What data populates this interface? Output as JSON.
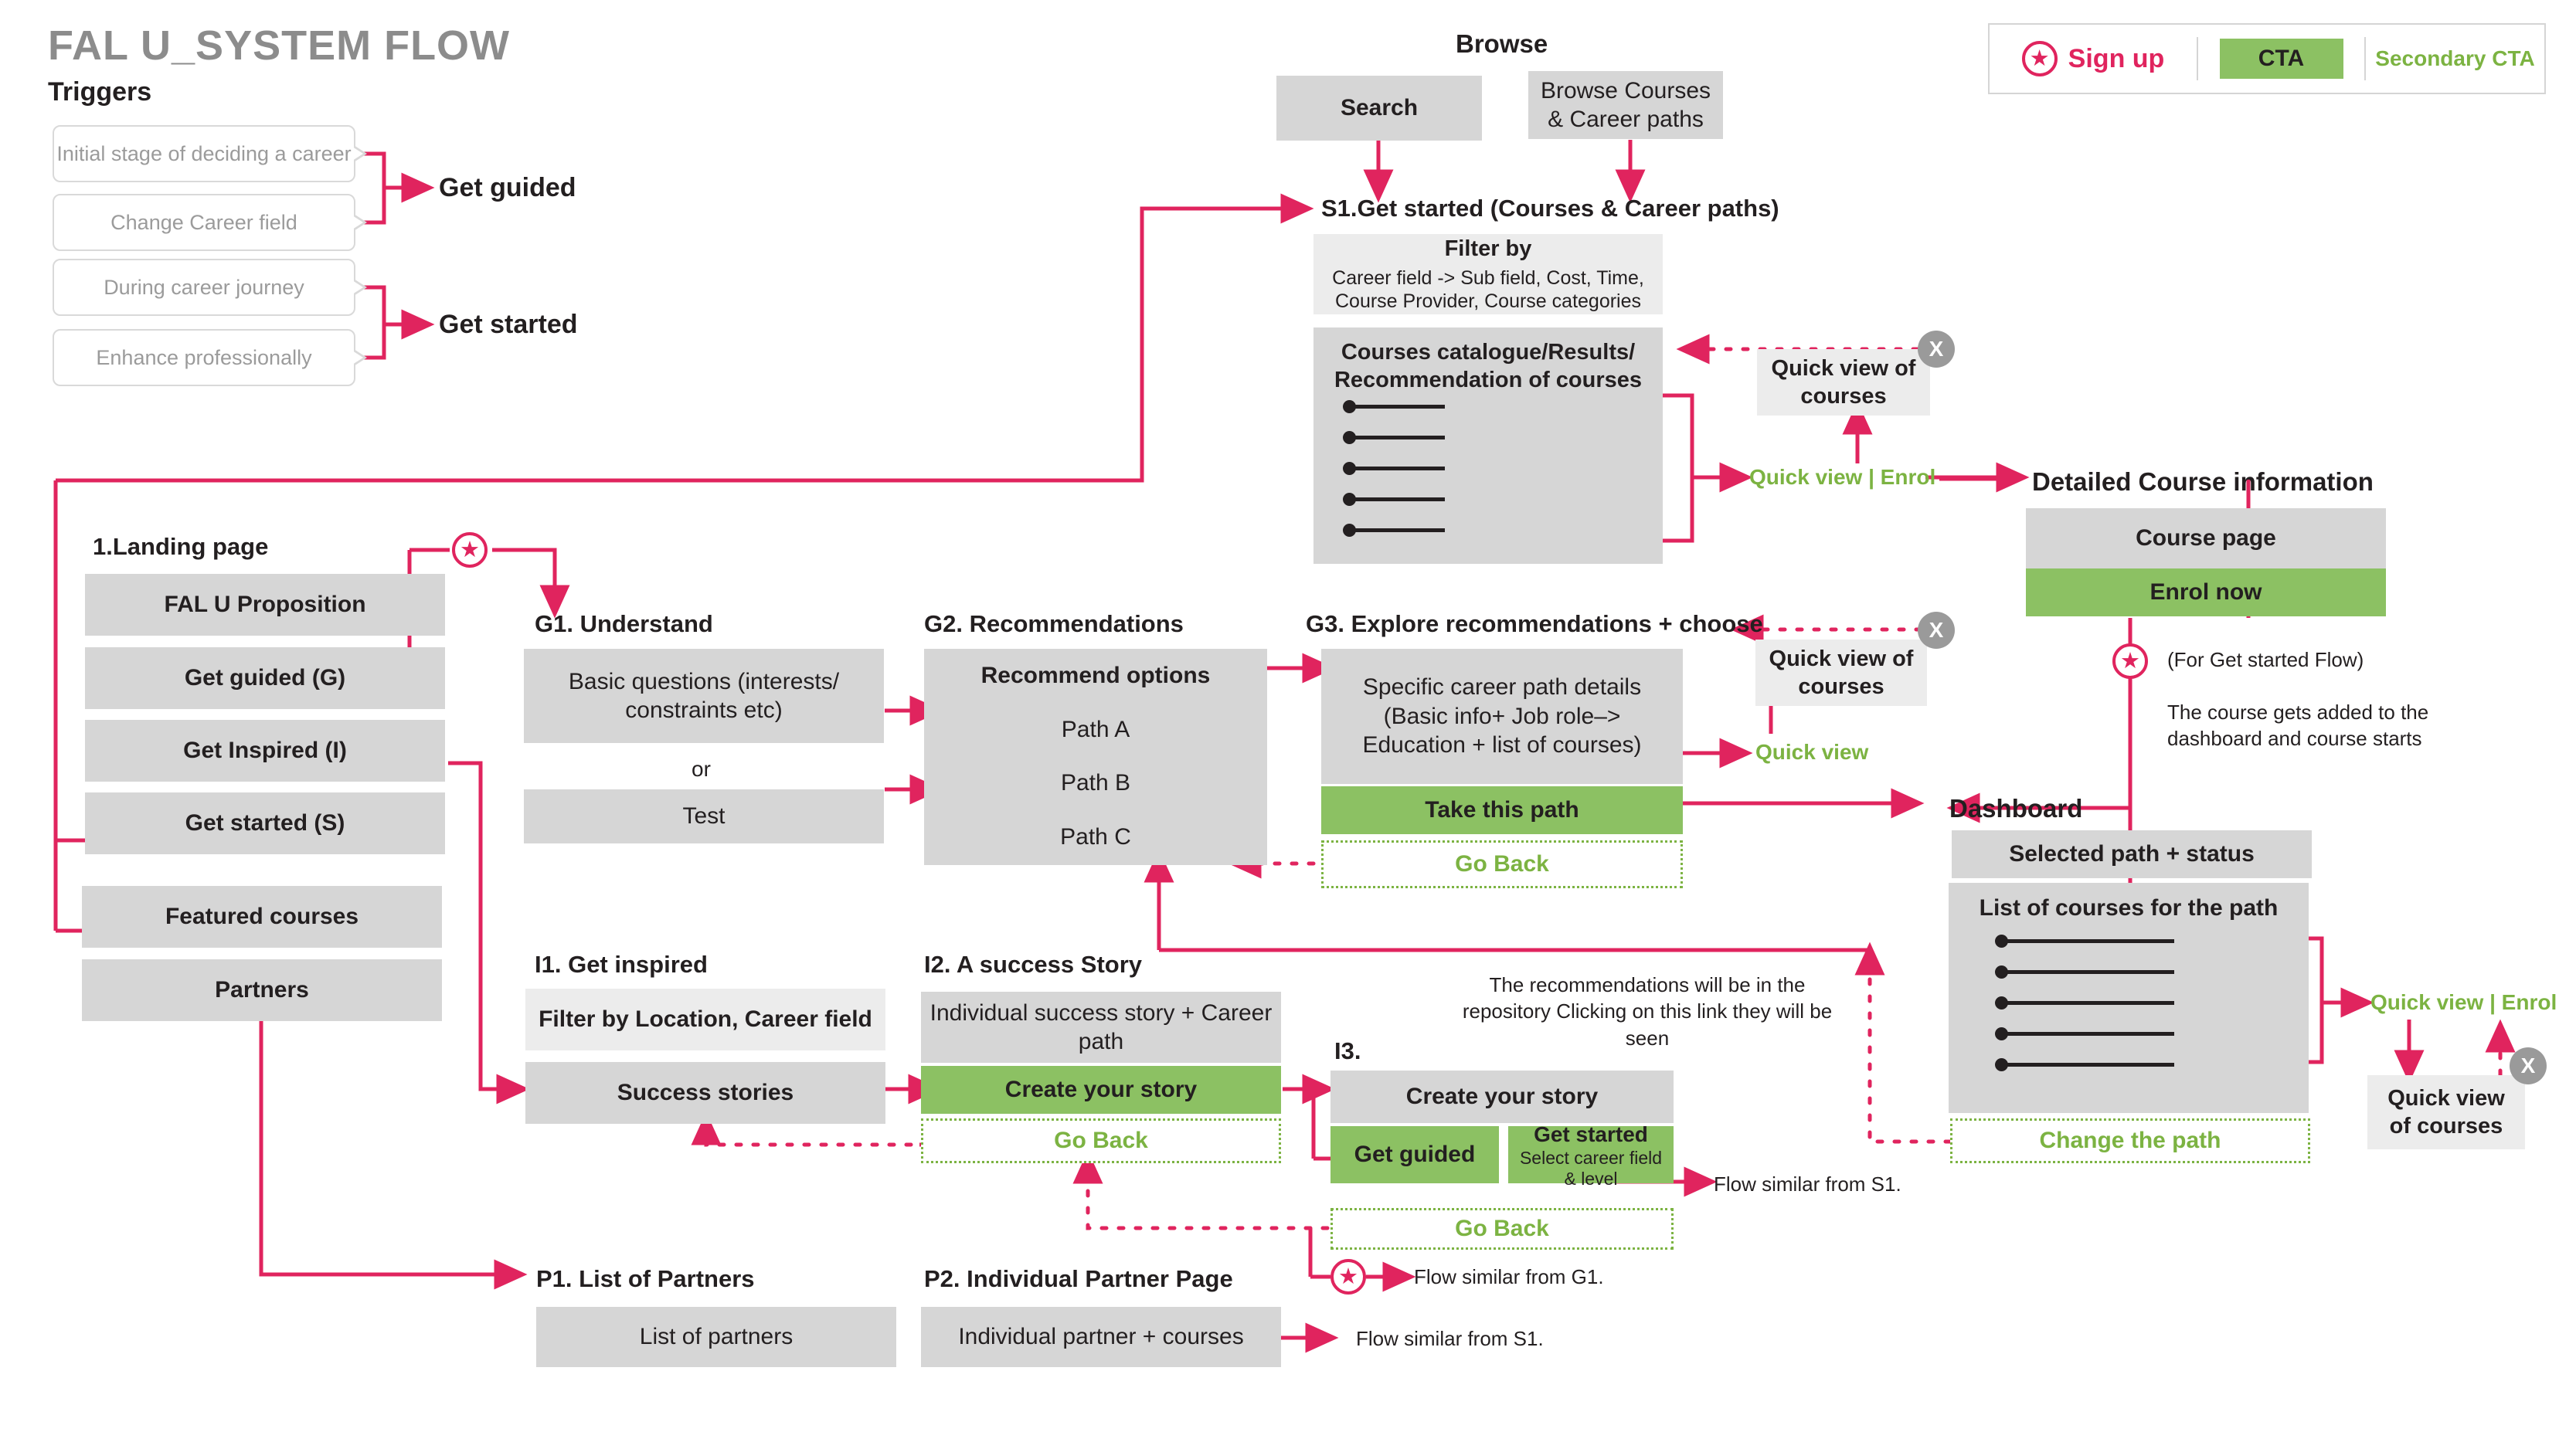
{
  "page": {
    "title": "FAL U_SYSTEM FLOW",
    "triggers_heading": "Triggers"
  },
  "legend": {
    "signup_label": "Sign up",
    "signup_icon": "star-icon",
    "cta_label": "CTA",
    "secondary_cta_label": "Secondary CTA",
    "colors": {
      "pink": "#e0245e",
      "green": "#8cc163",
      "secondary_green": "#7cb342",
      "gray_box": "#d6d6d6"
    }
  },
  "triggers": {
    "items": [
      {
        "label": "Initial stage of deciding a career"
      },
      {
        "label": "Change Career field"
      },
      {
        "label": "During career journey"
      },
      {
        "label": "Enhance professionally"
      }
    ],
    "outcomes": [
      {
        "label": "Get guided"
      },
      {
        "label": "Get started"
      }
    ]
  },
  "browse": {
    "heading": "Browse",
    "search_label": "Search",
    "browse_label": "Browse Courses & Career paths"
  },
  "s1": {
    "title": "S1.Get started (Courses & Career paths)",
    "filter": {
      "heading": "Filter by",
      "body": "Career field -> Sub field, Cost, Time, Course Provider, Course categories"
    },
    "catalogue": {
      "heading": "Courses catalogue/Results/ Recommendation of courses",
      "rows": 5
    },
    "quick_view_panel": "Quick view of courses",
    "close_label": "X",
    "links": "Quick view  |  Enrol"
  },
  "landing": {
    "title": "1.Landing page",
    "items": [
      {
        "label": "FAL U Proposition"
      },
      {
        "label": "Get guided (G)"
      },
      {
        "label": "Get Inspired (I)"
      },
      {
        "label": "Get started (S)"
      },
      {
        "label": "Featured courses"
      },
      {
        "label": "Partners"
      }
    ]
  },
  "g1": {
    "title": "G1. Understand",
    "primary": "Basic questions (interests/ constraints etc)",
    "or": "or",
    "secondary": "Test"
  },
  "g2": {
    "title": "G2. Recommendations",
    "heading": "Recommend options",
    "paths": [
      "Path A",
      "Path B",
      "Path C"
    ]
  },
  "g3": {
    "title": "G3. Explore recommendations + choose",
    "details": "Specific career path details (Basic info+ Job role–> Education + list of courses)",
    "cta": "Take this path",
    "go_back": "Go Back",
    "quick_view_link": "Quick view",
    "quick_view_panel": "Quick view of courses",
    "close_label": "X",
    "repository_note": "The recommendations will be in the repository Clicking on this link they will be seen"
  },
  "detailed_course": {
    "title": "Detailed Course information",
    "course_page": "Course page",
    "enrol_now": "Enrol now",
    "flow_note": "(For Get started Flow)",
    "description": "The course gets added to the dashboard and course starts"
  },
  "dashboard": {
    "title": "Dashboard",
    "selected_path": "Selected path + status",
    "list_heading": "List of courses for the path",
    "rows": 5,
    "change_path": "Change the path",
    "links": "Quick view  |  Enrol",
    "quick_view_panel": "Quick view of courses",
    "close_label": "X"
  },
  "i1": {
    "title": "I1. Get inspired",
    "filter": "Filter by Location, Career field",
    "success_stories": "Success stories"
  },
  "i2": {
    "title": "I2. A success Story",
    "story": "Individual success story + Career path",
    "cta": "Create your story",
    "go_back": "Go Back"
  },
  "i3": {
    "title": "I3.",
    "create_story": "Create your story",
    "get_guided": "Get guided",
    "get_started_title": "Get started",
    "get_started_sub": "Select career field & level",
    "go_back": "Go Back",
    "flow_note": "Flow similar from S1."
  },
  "p1": {
    "title": "P1. List of Partners",
    "box": "List of partners"
  },
  "p2": {
    "title": "P2. Individual Partner Page",
    "box": "Individual partner + courses",
    "flow_note": "Flow similar from S1."
  },
  "notes": {
    "flow_from_g1": "Flow similar from G1."
  }
}
